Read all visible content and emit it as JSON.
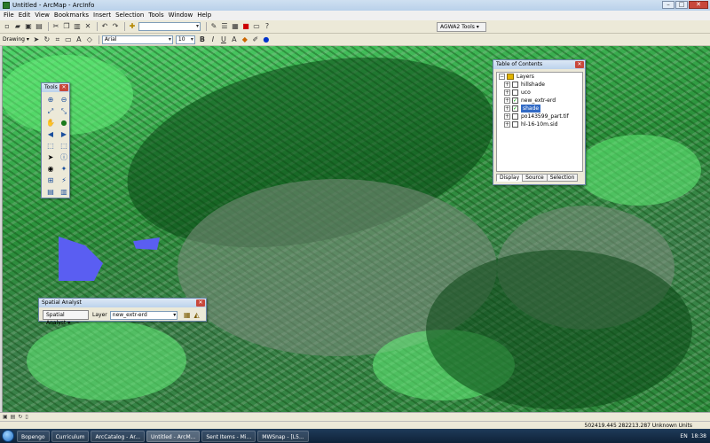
{
  "window": {
    "title": "Untitled - ArcMap - ArcInfo"
  },
  "menu": [
    "File",
    "Edit",
    "View",
    "Bookmarks",
    "Insert",
    "Selection",
    "Tools",
    "Window",
    "Help"
  ],
  "toolbar1": {
    "scale_value": "",
    "agwa_label": "AGWA2 Tools ▾"
  },
  "toolbar2": {
    "drawing_label": "Drawing ▾",
    "font_name": "Arial",
    "font_size": "10",
    "bold": "B",
    "italic": "I",
    "underline": "U",
    "text_color": "A"
  },
  "tools_window": {
    "title": "Tools"
  },
  "toc": {
    "title": "Table of Contents",
    "root_label": "Layers",
    "layers": [
      {
        "name": "hillshade",
        "checked": false,
        "selected": false
      },
      {
        "name": "uco",
        "checked": false,
        "selected": false
      },
      {
        "name": "new_extr-erd",
        "checked": true,
        "selected": false
      },
      {
        "name": "shade",
        "checked": true,
        "selected": true
      },
      {
        "name": "po143599_part.tif",
        "checked": false,
        "selected": false
      },
      {
        "name": "hl-16-10m.sid",
        "checked": false,
        "selected": false
      }
    ],
    "tabs": [
      "Display",
      "Source",
      "Selection"
    ]
  },
  "spatial_analyst": {
    "title": "Spatial Analyst",
    "menu_label": "Spatial Analyst ▾",
    "layer_label": "Layer",
    "layer_value": "new_extr-erd"
  },
  "status": {
    "coordinates": "502419.445  282213.287 Unknown Units"
  },
  "taskbar": {
    "items": [
      "Bopengo",
      "Curriculum",
      "ArcCatalog - Ar...",
      "Untitled - ArcM...",
      "Sent Items - Mi...",
      "MWSnap - [L5..."
    ],
    "active_index": 3,
    "language": "EN",
    "clock": "18:38"
  }
}
